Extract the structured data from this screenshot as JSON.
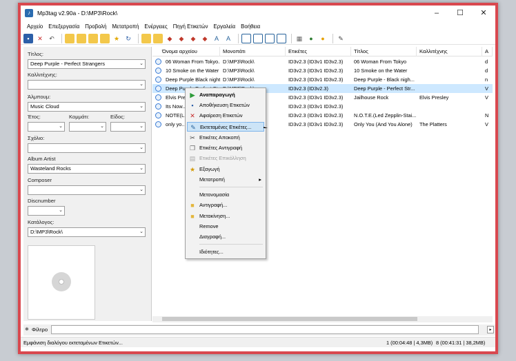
{
  "title": "Mp3tag v2.90a  -  D:\\MP3\\Rock\\",
  "menu": [
    "Αρχείο",
    "Επεξεργασία",
    "Προβολή",
    "Μετατροπή",
    "Ενέργειες",
    "Πηγή Ετικετών",
    "Εργαλεία",
    "Βοήθεια"
  ],
  "fields": {
    "title_label": "Τίτλος:",
    "title_value": "Deep Purple - Perfect Strangers",
    "artist_label": "Καλλιτέχνης:",
    "artist_value": "",
    "album_label": "Άλμπουμ:",
    "album_value": "Music Cloud",
    "year_label": "Έτος:",
    "track_label": "Κομμάτι:",
    "genre_label": "Είδος:",
    "comment_label": "Σχόλιο:",
    "albumartist_label": "Album Artist",
    "albumartist_value": "Wasteland Rocks",
    "composer_label": "Composer",
    "disc_label": "Discnumber",
    "dir_label": "Κατάλογος:",
    "dir_value": "D:\\MP3\\Rock\\"
  },
  "columns": [
    "Όνομα αρχείου",
    "Μονοπάτι",
    "Ετικέτες",
    "Τίτλος",
    "Καλλιτέχνης",
    "Α"
  ],
  "rows": [
    [
      "06 Woman From Tokyo...",
      "D:\\MP3\\Rock\\",
      "ID3v2.3 (ID3v1 ID3v2.3)",
      "06 Woman From Tokyo",
      "",
      "d"
    ],
    [
      "10 Smoke on the Water",
      "D:\\MP3\\Rock\\",
      "ID3v2.3 (ID3v1 ID3v2.3)",
      "10 Smoke on the Water",
      "",
      "d"
    ],
    [
      "Deep Purple  Black night...",
      "D:\\MP3\\Rock\\",
      "ID3v2.3 (ID3v1 ID3v2.3)",
      "Deep Purple - Black nigh...",
      "",
      "n"
    ],
    [
      "Deep Purple  Perfect Stra...",
      "D:\\MP3\\Rock\\",
      "ID3v2.3 (ID3v2.3)",
      "Deep Purple - Perfect Str...",
      "",
      "V"
    ],
    [
      "Elvis Pre...",
      "",
      "ID3v2.3 (ID3v1 ID3v2.3)",
      "Jailhouse Rock",
      "Elvis Presley",
      "V"
    ],
    [
      "Its Now...",
      "",
      "ID3v2.3 (ID3v1 ID3v2.3)",
      "",
      "",
      ""
    ],
    [
      "NOTE(L...",
      "",
      "ID3v2.3 (ID3v1 ID3v2.3)",
      "N.O.T.E.(Led Zepplin-Stai...",
      "",
      "N"
    ],
    [
      "only yo...",
      "",
      "ID3v2.3 (ID3v1 ID3v2.3)",
      "Only You (And You Alone)",
      "The Platters",
      "V"
    ]
  ],
  "context_menu": {
    "play": "Αναπαραγωγή",
    "save": "Αποθήκευση Ετικετών",
    "remove": "Αφαίρεση Ετικετών",
    "extended": "Εκτεταμένες Ετικέτες...",
    "cut": "Ετικέτες Αποκοπή",
    "copy": "Ετικέτες Αντιγραφή",
    "paste": "Ετικέτες Επικόλληση",
    "export": "Εξαγωγή",
    "convert": "Μετατροπή",
    "rename": "Μετονομασία",
    "copyto": "Αντιγραφή...",
    "move": "Μετακίνηση...",
    "remove2": "Remove",
    "delete": "Διαγραφή...",
    "props": "Ιδιότητες..."
  },
  "filter_label": "Φίλτρο",
  "status": {
    "text": "Εμφάνιση διαλόγου εκτεταμένων Ετικετών...",
    "sel": "1 (00:04:48 | 4,3MB)",
    "total": "8 (00:41:31 | 38,2MB)"
  },
  "colors": {
    "accent": "#d9484f",
    "selection": "#cde8ff"
  }
}
